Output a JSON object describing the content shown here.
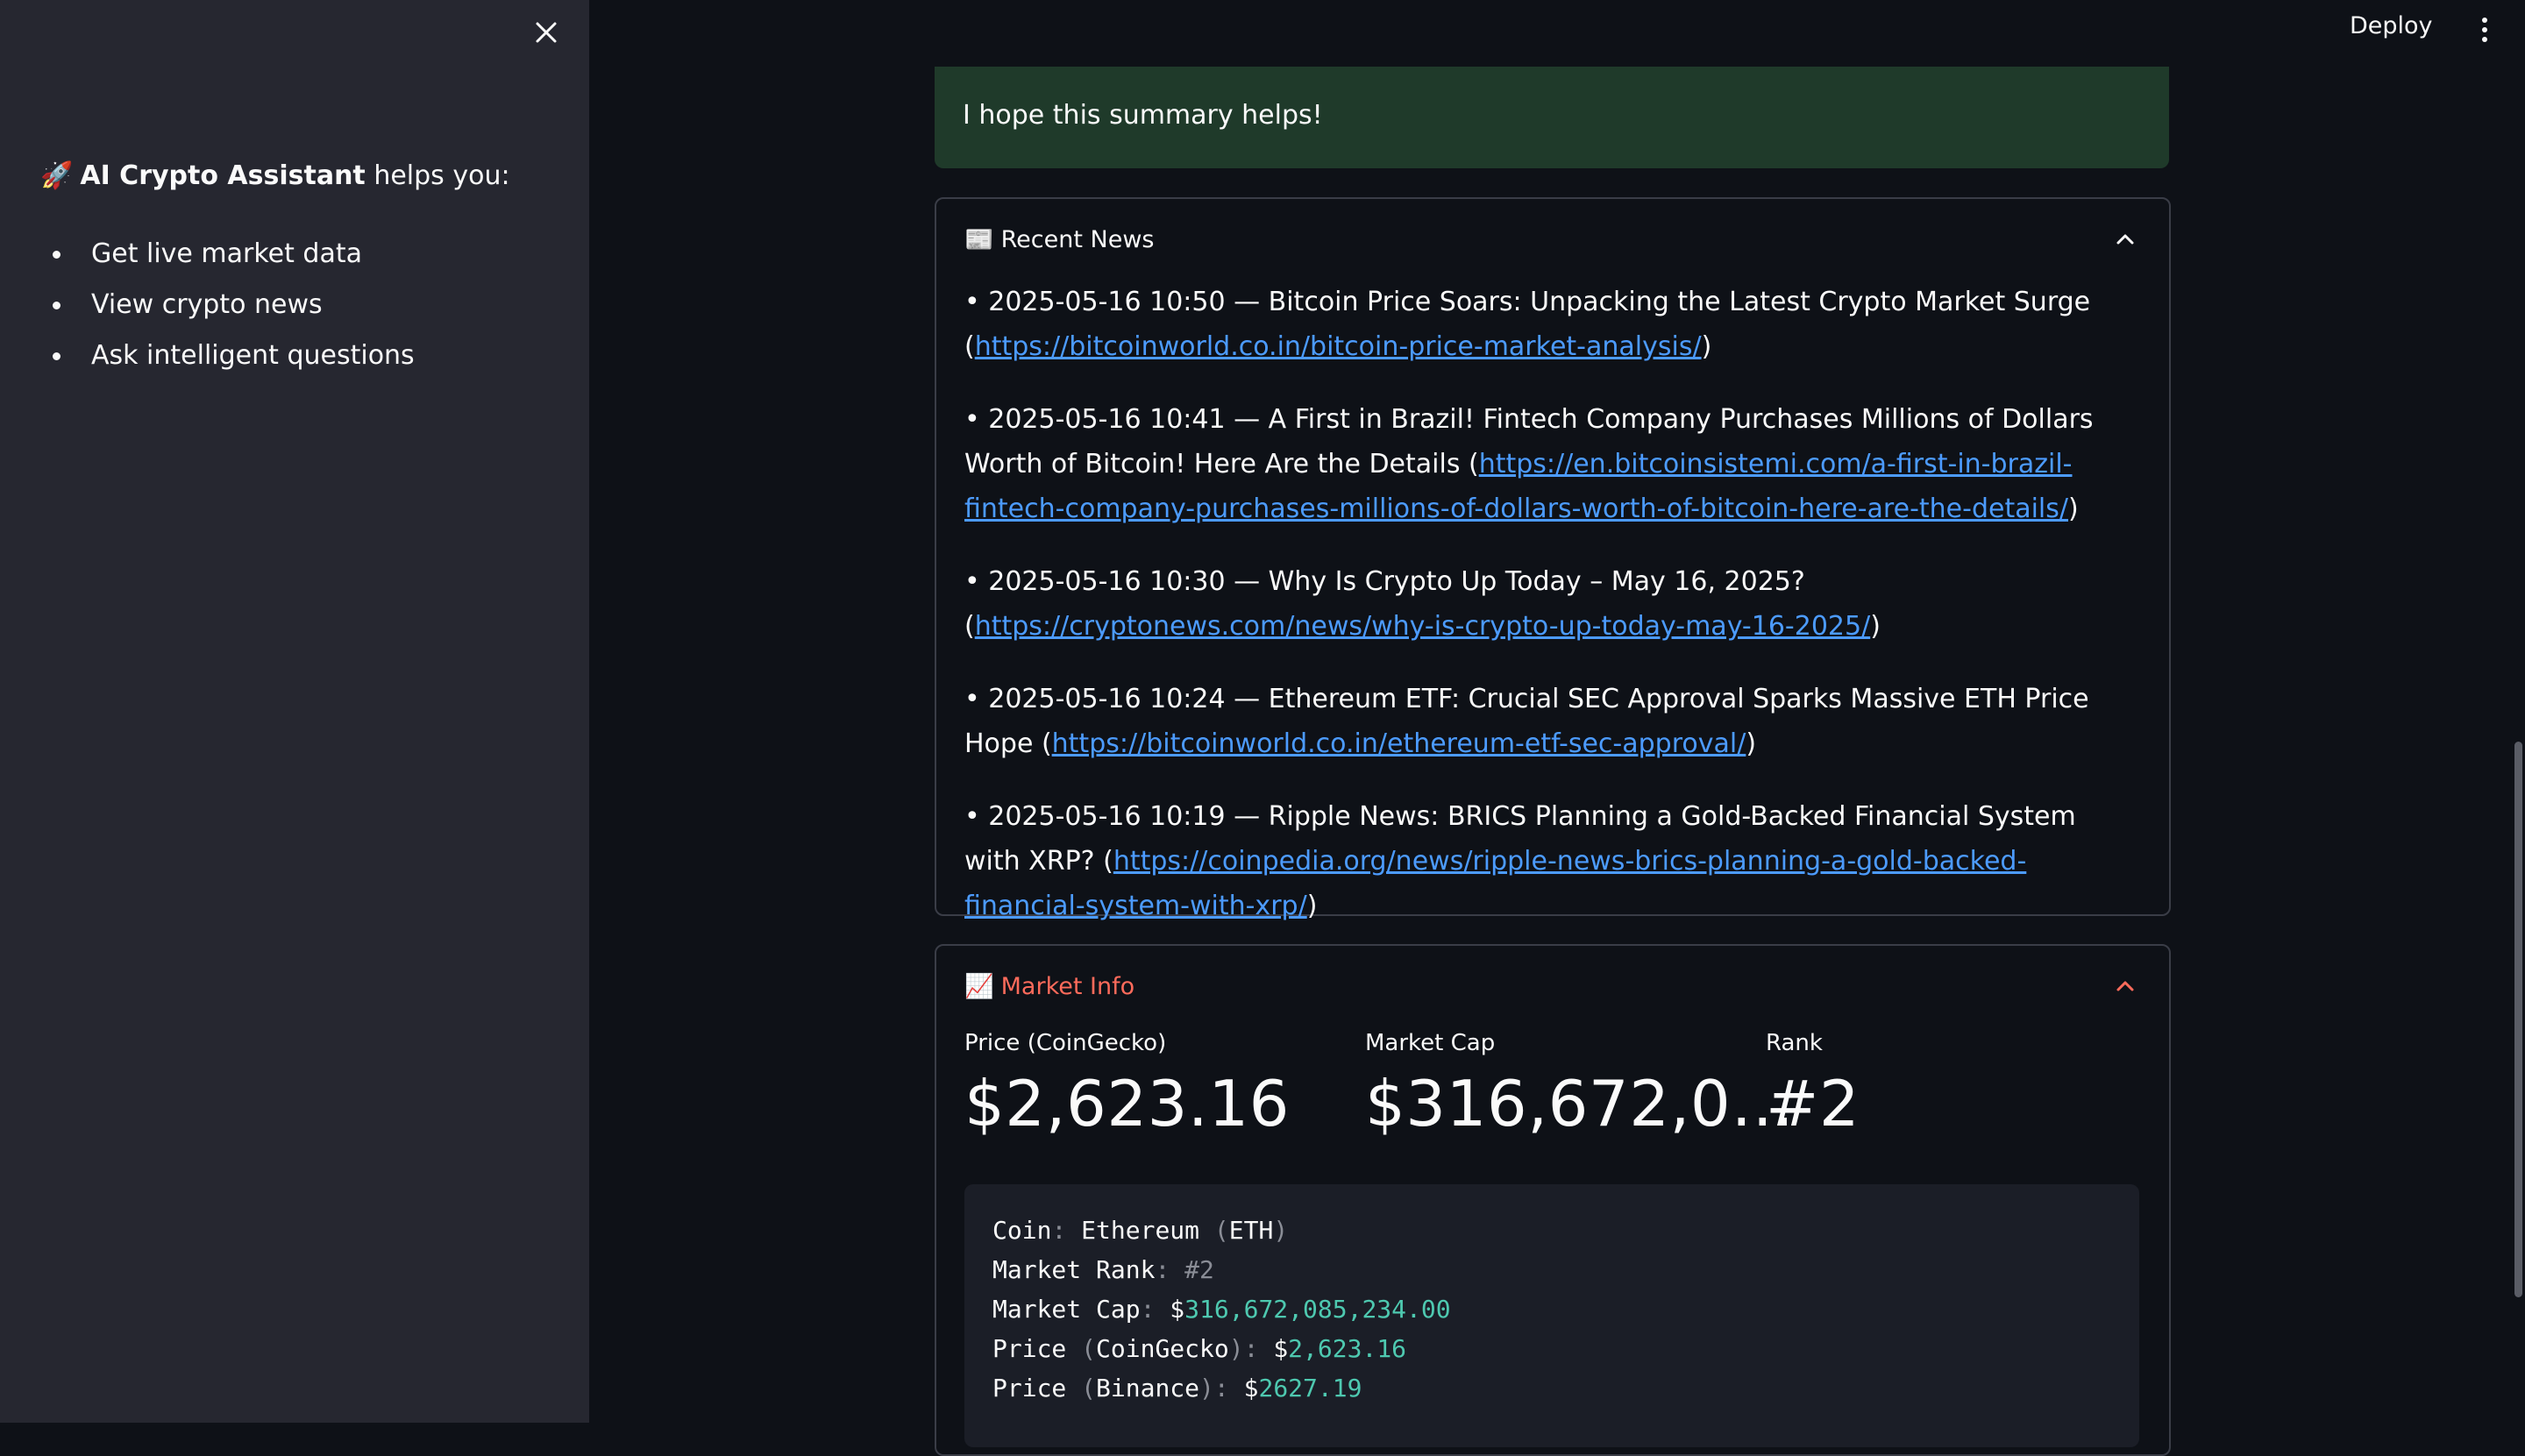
{
  "sidebar": {
    "intro_emoji": "🚀",
    "intro_bold": "AI Crypto Assistant",
    "intro_rest": " helps you:",
    "items": [
      "Get live market data",
      "View crypto news",
      "Ask intelligent questions"
    ]
  },
  "topbar": {
    "deploy_label": "Deploy"
  },
  "success": {
    "text": "I hope this summary helps!"
  },
  "news": {
    "emoji": "📰",
    "title": "Recent News",
    "items": [
      {
        "prefix": "• 2025-05-16 10:50 — Bitcoin Price Soars: Unpacking the Latest Crypto Market Surge (",
        "url": "https://bitcoinworld.co.in/bitcoin-price-market-analysis/",
        "suffix": ")"
      },
      {
        "prefix": "• 2025-05-16 10:41 — A First in Brazil! Fintech Company Purchases Millions of Dollars Worth of Bitcoin! Here Are the Details (",
        "url": "https://en.bitcoinsistemi.com/a-first-in-brazil-fintech-company-purchases-millions-of-dollars-worth-of-bitcoin-here-are-the-details/",
        "suffix": ")"
      },
      {
        "prefix": "• 2025-05-16 10:30 — Why Is Crypto Up Today – May 16, 2025? (",
        "url": "https://cryptonews.com/news/why-is-crypto-up-today-may-16-2025/",
        "suffix": ")"
      },
      {
        "prefix": "• 2025-05-16 10:24 — Ethereum ETF: Crucial SEC Approval Sparks Massive ETH Price Hope (",
        "url": "https://bitcoinworld.co.in/ethereum-etf-sec-approval/",
        "suffix": ")"
      },
      {
        "prefix": "• 2025-05-16 10:19 — Ripple News: BRICS Planning a Gold-Backed Financial System with XRP? (",
        "url": "https://coinpedia.org/news/ripple-news-brics-planning-a-gold-backed-financial-system-with-xrp/",
        "suffix": ")"
      }
    ]
  },
  "market": {
    "emoji": "📈",
    "title": "Market Info",
    "title_color": "#ff6b5b",
    "metrics": [
      {
        "label": "Price (CoinGecko)",
        "value": "$2,623.16"
      },
      {
        "label": "Market Cap",
        "value": "$316,672,0…"
      },
      {
        "label": "Rank",
        "value": "#2"
      }
    ],
    "code": {
      "coin_key": "Coin",
      "coin_val": "Ethereum",
      "coin_sym": "ETH",
      "rank_key": "Market Rank",
      "rank_val": "#2",
      "cap_key": "Market Cap",
      "cap_cur": "$",
      "cap_val": "316,672,085,234.00",
      "pcg_key": "Price",
      "pcg_src": "CoinGecko",
      "pcg_cur": "$",
      "pcg_val": "2,623.16",
      "pbn_key": "Price",
      "pbn_src": "Binance",
      "pbn_cur": "$",
      "pbn_val": "2627.19"
    }
  },
  "colors": {
    "link": "#4c9bff",
    "accent": "#ff6b5b",
    "code_number": "#4ec9b0",
    "success_bg": "#1f3a2a"
  }
}
